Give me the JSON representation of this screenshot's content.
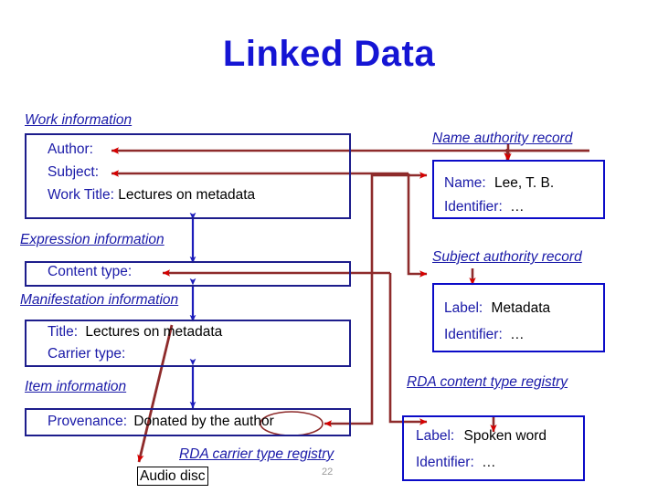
{
  "slide": {
    "title": "Linked Data",
    "page_number": "22",
    "colors": {
      "title_blue": "#1515d4",
      "caption_blue": "#1a1aa8",
      "box_border_left": "#1d1d8c",
      "box_border_right": "#0b0bc8",
      "connector_red": "#8e2b2b",
      "arrowhead_red": "#d50000",
      "value_black": "#000000",
      "page_gray": "#9a9a9a"
    }
  },
  "left_column": {
    "work": {
      "caption": "Work information",
      "rows": [
        {
          "label": "Author:",
          "value": ""
        },
        {
          "label": "Subject:",
          "value": ""
        },
        {
          "label": "Work Title:",
          "value": "Lectures on metadata"
        }
      ]
    },
    "expression": {
      "caption": "Expression information",
      "rows": [
        {
          "label": "Content type:",
          "value": ""
        }
      ]
    },
    "manifestation": {
      "caption": "Manifestation information",
      "rows": [
        {
          "label": "Title:",
          "value": "Lectures on metadata"
        },
        {
          "label": "Carrier type:",
          "value": ""
        }
      ]
    },
    "item": {
      "caption": "Item information",
      "rows": [
        {
          "label": "Provenance:",
          "value": "Donated by the author",
          "circled_word": "author"
        }
      ]
    },
    "carrier_registry": {
      "caption": "RDA carrier type registry",
      "value_box": "Audio disc"
    }
  },
  "right_column": {
    "name_authority": {
      "caption": "Name authority record",
      "rows": [
        {
          "label": "Name:",
          "value": "Lee, T. B."
        },
        {
          "label": "Identifier:",
          "value": "…"
        }
      ]
    },
    "subject_authority": {
      "caption": "Subject authority record",
      "rows": [
        {
          "label": "Label:",
          "value": "Metadata"
        },
        {
          "label": "Identifier:",
          "value": "…"
        }
      ]
    },
    "content_registry": {
      "caption": "RDA content type registry",
      "rows": [
        {
          "label": "Label:",
          "value": "Spoken word"
        },
        {
          "label": "Identifier:",
          "value": "…"
        }
      ]
    }
  },
  "connectors": {
    "name_to_author": "Name authority record → Author:",
    "subject_to_subject": "Subject authority record → Subject:",
    "content_to_content_type": "RDA content type registry → Content type:",
    "author_word_to_name_authority": "author → Name authority record",
    "carrier_type_to_audio_disc": "Carrier type: → Audio disc"
  }
}
